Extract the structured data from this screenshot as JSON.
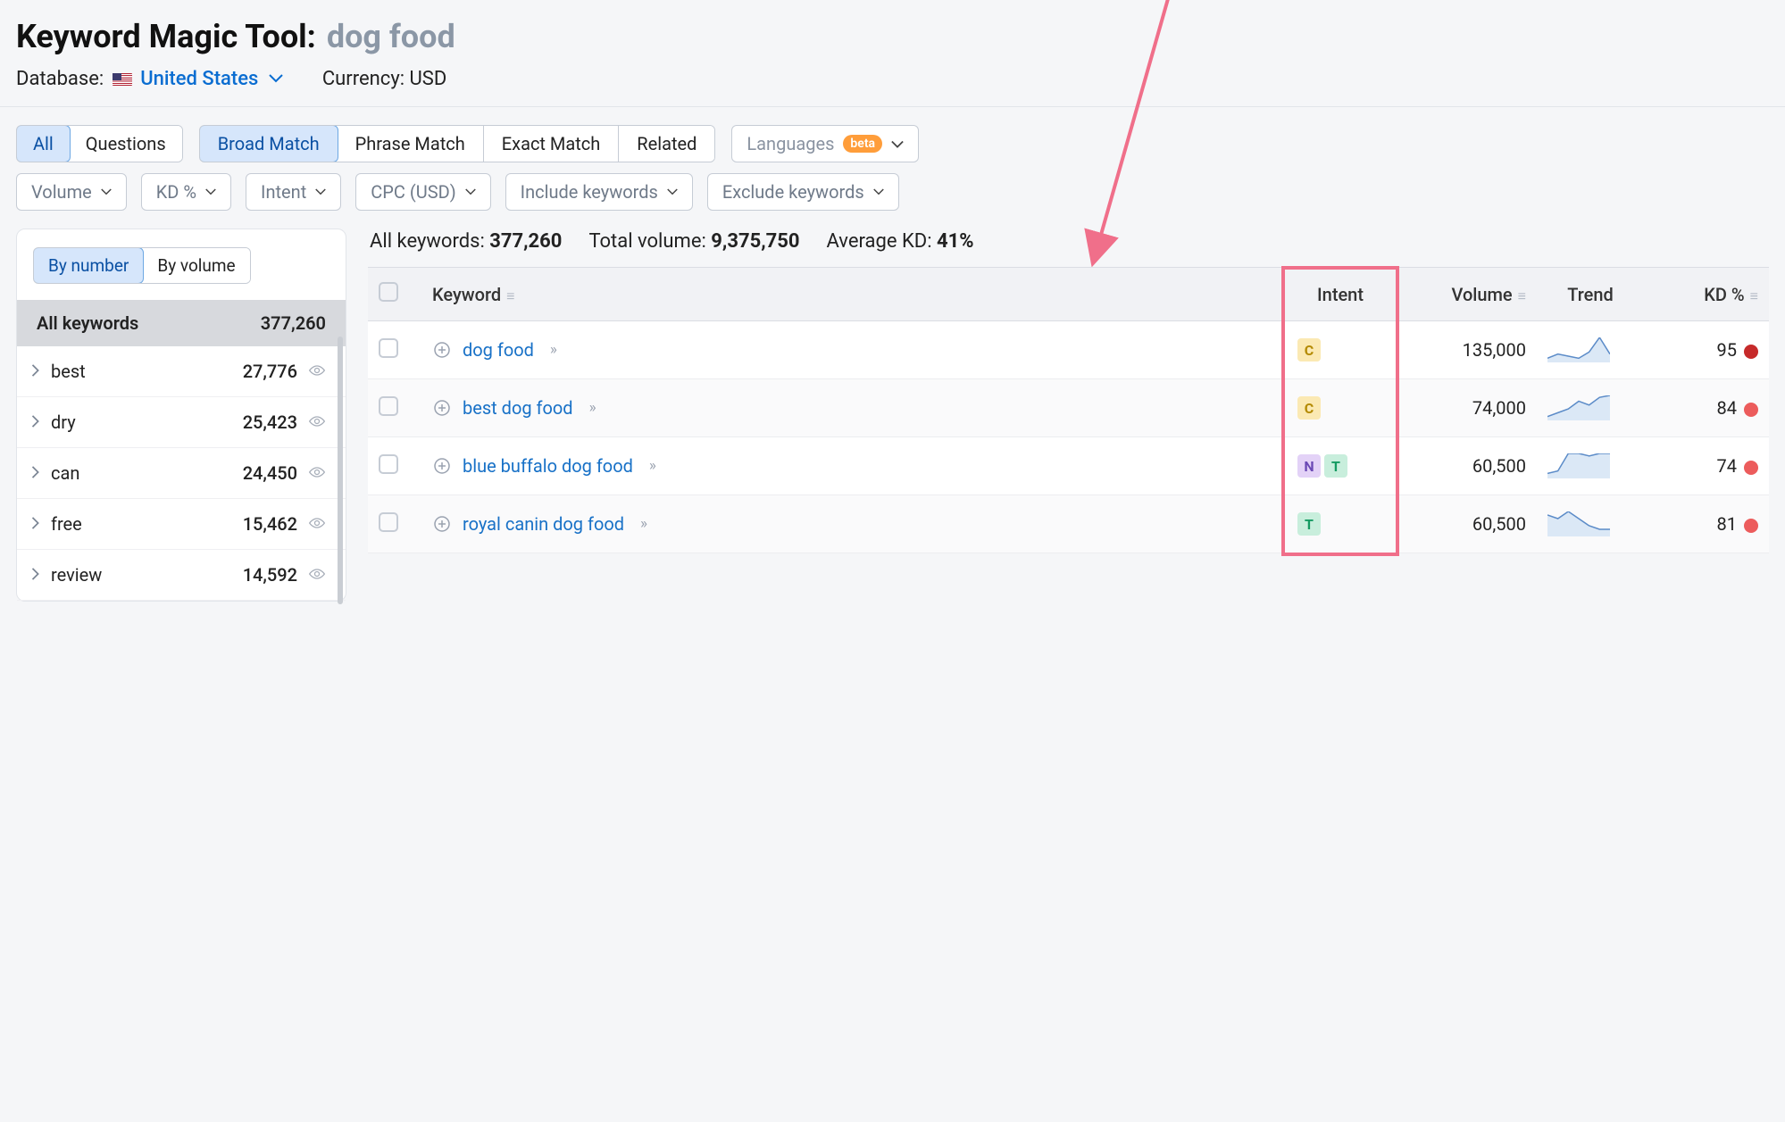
{
  "header": {
    "tool_title": "Keyword Magic Tool:",
    "keyword": "dog food",
    "database_label": "Database:",
    "country": "United States",
    "currency_label": "Currency: USD"
  },
  "tabs": {
    "all": "All",
    "questions": "Questions",
    "broad_match": "Broad Match",
    "phrase_match": "Phrase Match",
    "exact_match": "Exact Match",
    "related": "Related",
    "languages": "Languages",
    "beta": "beta"
  },
  "filters": {
    "volume": "Volume",
    "kd": "KD %",
    "intent": "Intent",
    "cpc": "CPC (USD)",
    "include": "Include keywords",
    "exclude": "Exclude keywords"
  },
  "sidebar": {
    "by_number": "By number",
    "by_volume": "By volume",
    "all_keywords_label": "All keywords",
    "all_keywords_count": "377,260",
    "groups": [
      {
        "name": "best",
        "count": "27,776"
      },
      {
        "name": "dry",
        "count": "25,423"
      },
      {
        "name": "can",
        "count": "24,450"
      },
      {
        "name": "free",
        "count": "15,462"
      },
      {
        "name": "review",
        "count": "14,592"
      }
    ]
  },
  "stats": {
    "all_keywords_label": "All keywords:",
    "all_keywords_value": "377,260",
    "total_volume_label": "Total volume:",
    "total_volume_value": "9,375,750",
    "avg_kd_label": "Average KD:",
    "avg_kd_value": "41%"
  },
  "columns": {
    "keyword": "Keyword",
    "intent": "Intent",
    "volume": "Volume",
    "trend": "Trend",
    "kd": "KD %"
  },
  "intent_colors": {
    "C": "#b48a00",
    "N": "#6b49b5",
    "T": "#159b62",
    "I": "#2a7cc7"
  },
  "rows": [
    {
      "keyword": "dog food",
      "intents": [
        "C"
      ],
      "volume": "135,000",
      "kd": "95",
      "kd_color": "#c62a2a",
      "spark": [
        12,
        14,
        13,
        12,
        15,
        22,
        14
      ]
    },
    {
      "keyword": "best dog food",
      "intents": [
        "C"
      ],
      "volume": "74,000",
      "kd": "84",
      "kd_color": "#ec5c5c",
      "spark": [
        10,
        12,
        14,
        18,
        16,
        20,
        21
      ]
    },
    {
      "keyword": "blue buffalo dog food",
      "intents": [
        "N",
        "T"
      ],
      "volume": "60,500",
      "kd": "74",
      "kd_color": "#ec5c5c",
      "spark": [
        14,
        15,
        22,
        22,
        21,
        22,
        22
      ]
    },
    {
      "keyword": "royal canin dog food",
      "intents": [
        "T"
      ],
      "volume": "60,500",
      "kd": "81",
      "kd_color": "#ec5c5c",
      "spark": [
        18,
        17,
        19,
        17,
        15,
        14,
        14
      ]
    }
  ],
  "annotation_arrow": {
    "color": "#f06f8a"
  }
}
